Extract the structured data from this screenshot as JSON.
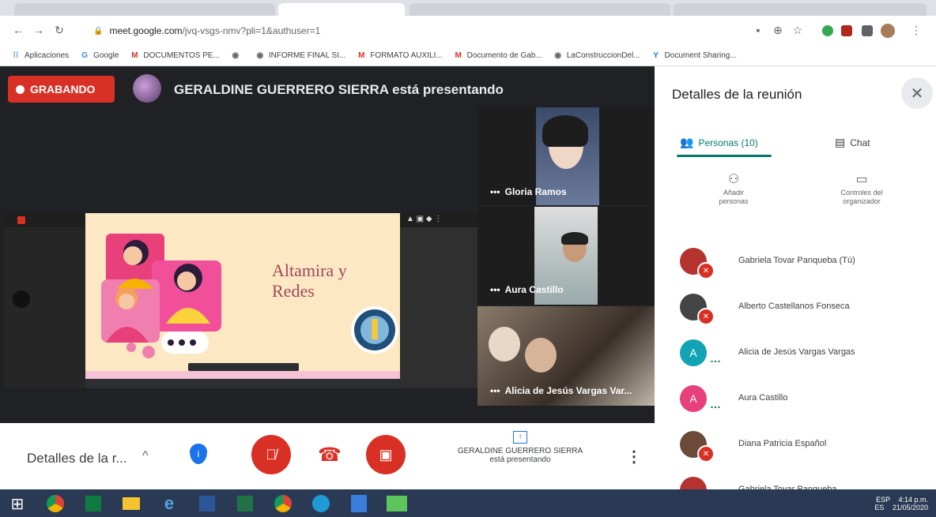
{
  "browser": {
    "url_host": "meet.google.com",
    "url_path": "/jvq-vsgs-nmv?pli=1&authuser=1",
    "bookmarks": [
      {
        "label": "Aplicaciones",
        "icon": "apps-grid-icon",
        "color": "#4285f4"
      },
      {
        "label": "Google",
        "icon": "google-icon",
        "color": "#4285f4"
      },
      {
        "label": "DOCUMENTOS PE...",
        "icon": "gmail-icon",
        "color": "#d93025"
      },
      {
        "label": "",
        "icon": "globe-icon",
        "color": "#5f6368"
      },
      {
        "label": "INFORME FINAL SI...",
        "icon": "globe-icon",
        "color": "#5f6368"
      },
      {
        "label": "FORMATO AUXILI...",
        "icon": "gmail-icon",
        "color": "#d93025"
      },
      {
        "label": "Documento de Gab...",
        "icon": "gmail-icon",
        "color": "#d93025"
      },
      {
        "label": "LaConstruccionDel...",
        "icon": "globe-icon",
        "color": "#5f6368"
      },
      {
        "label": "Document Sharing...",
        "icon": "yammer-icon",
        "color": "#1a73e8"
      }
    ]
  },
  "meet": {
    "recording_label": "GRABANDO",
    "presenter_text": "GERALDINE GUERRERO SIERRA está presentando",
    "slide_title_line1": "Altamira y",
    "slide_title_line2": "Redes",
    "tiles": [
      {
        "name": "Gloria Ramos"
      },
      {
        "name": "Aura Castillo"
      },
      {
        "name": "Alicia de Jesús Vargas Var..."
      }
    ]
  },
  "controls": {
    "details_label": "Detalles de la r...",
    "presenting_line1": "GERALDINE GUERRERO SIERRA",
    "presenting_line2": "está presentando"
  },
  "panel": {
    "title": "Detalles de la reunión",
    "people_tab": "Personas (10)",
    "chat_tab": "Chat",
    "add_people_line1": "Añadir",
    "add_people_line2": "personas",
    "host_controls_line1": "Controles del",
    "host_controls_line2": "organizador",
    "participants": [
      {
        "name": "Gabriela Tovar Panqueba (Tú)",
        "initial": "",
        "color": "#b5332e"
      },
      {
        "name": "Alberto Castellanos Fonseca",
        "initial": "",
        "color": "#444444"
      },
      {
        "name": "Alicia de Jesús Vargas Vargas",
        "initial": "A",
        "color": "#12a4b5"
      },
      {
        "name": "Aura Castillo",
        "initial": "A",
        "color": "#e8407a"
      },
      {
        "name": "Diana Patricia Español",
        "initial": "",
        "color": "#6b4a3a"
      },
      {
        "name": "Gabriela Tovar Panqueba",
        "initial": "",
        "color": "#b5332e"
      }
    ]
  },
  "taskbar": {
    "lang": "ESP",
    "lang2": "ES",
    "time": "4:14 p.m.",
    "date": "21/05/2020"
  }
}
